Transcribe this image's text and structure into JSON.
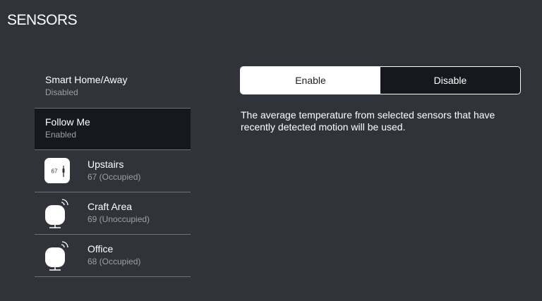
{
  "page": {
    "title": "SENSORS"
  },
  "sidebar": {
    "modes": [
      {
        "label": "Smart Home/Away",
        "status": "Disabled"
      },
      {
        "label": "Follow Me",
        "status": "Enabled"
      }
    ],
    "sensors": [
      {
        "label": "Upstairs",
        "reading": "67 (Occupied)",
        "icon": "thermostat-icon",
        "icon_text": "67"
      },
      {
        "label": "Craft Area",
        "reading": "69 (Unoccupied)",
        "icon": "remote-sensor-icon"
      },
      {
        "label": "Office",
        "reading": "68 (Occupied)",
        "icon": "remote-sensor-icon"
      }
    ]
  },
  "toggle": {
    "enable_label": "Enable",
    "disable_label": "Disable",
    "selected": "Enable"
  },
  "description": "The average temperature from selected sensors that have recently detected motion will be used.",
  "colors": {
    "background": "#30343a",
    "selected_background": "#15191d",
    "divider": "#6e7277",
    "secondary_text": "#9ba0a5"
  }
}
